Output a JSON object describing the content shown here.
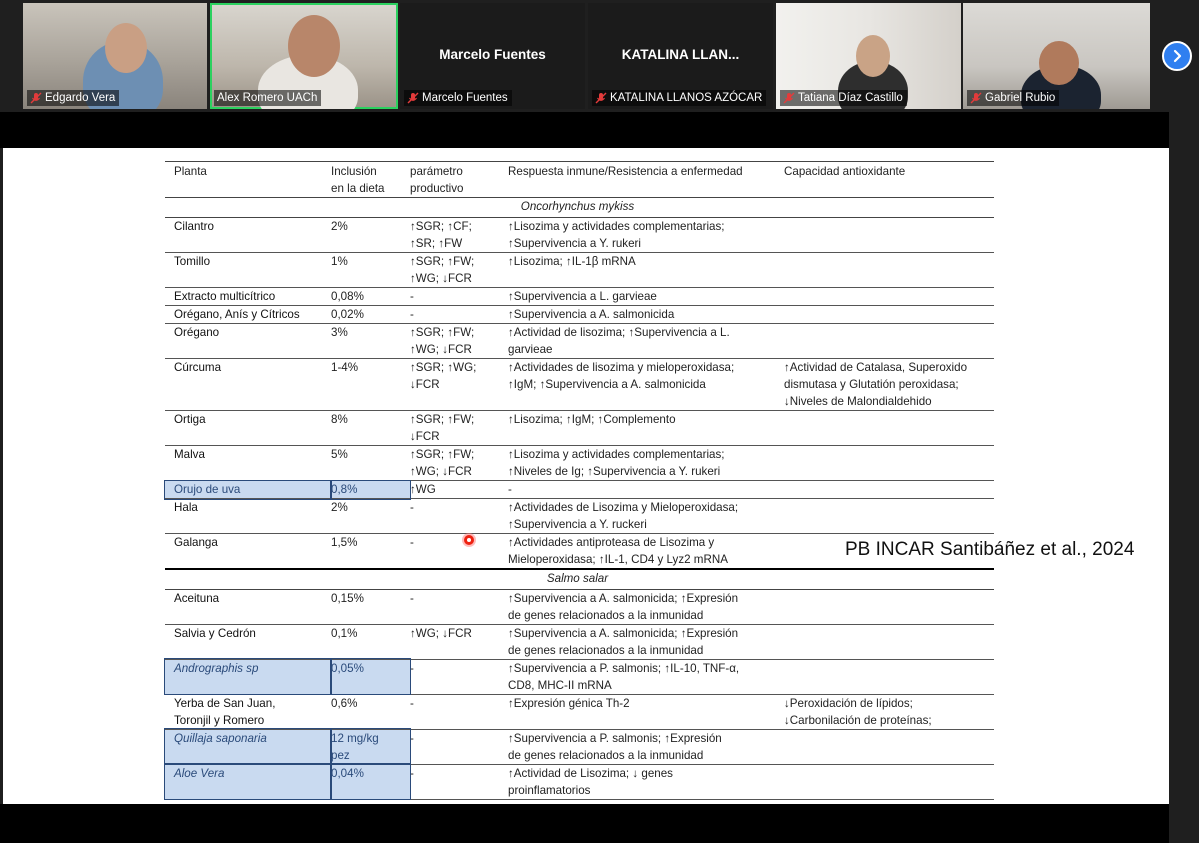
{
  "participants": [
    {
      "name": "Edgardo Vera",
      "muted": true,
      "video": true
    },
    {
      "name": "Alex Romero UACh",
      "muted": false,
      "video": true,
      "speaking": true
    },
    {
      "name": "Marcelo Fuentes",
      "center_label": "Marcelo Fuentes",
      "muted": true,
      "video": false
    },
    {
      "name": "KATALINA LLANOS AZÓCAR",
      "center_label": "KATALINA LLAN...",
      "muted": true,
      "video": false
    },
    {
      "name": "Tatiana Díaz Castillo",
      "muted": true,
      "video": true
    },
    {
      "name": "Gabriel Rubio",
      "muted": true,
      "video": true
    }
  ],
  "controls": {
    "next_icon": "chevron-right-icon",
    "accent": "#2f7ff0",
    "speaking_color": "#2bd15f",
    "mic_off_color": "#e33b3b"
  },
  "slide": {
    "headers": [
      "Planta",
      "Inclusión\nen la dieta",
      "parámetro\nproductivo",
      "Respuesta inmune/Resistencia a enfermedad",
      "Capacidad antioxidante"
    ],
    "sections": [
      {
        "species": "Oncorhynchus mykiss",
        "rows": [
          {
            "planta": "Cilantro",
            "inclusion": "2%",
            "parametro": "↑SGR; ↑CF;\n↑SR; ↑FW",
            "respuesta": "↑Lisozima y actividades complementarias;\n↑Supervivencia a Y. rukeri",
            "antioxidante": ""
          },
          {
            "planta": "Tomillo",
            "inclusion": "1%",
            "parametro": "↑SGR; ↑FW;\n↑WG; ↓FCR",
            "respuesta": "↑Lisozima; ↑IL-1β mRNA",
            "antioxidante": ""
          },
          {
            "planta": "Extracto multicítrico",
            "inclusion": "0,08%",
            "parametro": "-",
            "respuesta": "↑Supervivencia a L. garvieae",
            "antioxidante": ""
          },
          {
            "planta": "Orégano, Anís y Cítricos",
            "inclusion": "0,02%",
            "parametro": "-",
            "respuesta": "↑Supervivencia a A. salmonicida",
            "antioxidante": ""
          },
          {
            "planta": "Orégano",
            "inclusion": "3%",
            "parametro": "↑SGR; ↑FW;\n↑WG; ↓FCR",
            "respuesta": "↑Actividad de lisozima; ↑Supervivencia a L.\ngarvieae",
            "antioxidante": ""
          },
          {
            "planta": "Cúrcuma",
            "inclusion": "1-4%",
            "parametro": "↑SGR; ↑WG;\n↓FCR",
            "respuesta": "↑Actividades de lisozima y mieloperoxidasa;\n↑IgM; ↑Supervivencia a A. salmonicida",
            "antioxidante": "↑Actividad de Catalasa, Superoxido\ndismutasa y Glutatión peroxidasa;\n↓Niveles de Malondialdehido"
          },
          {
            "planta": "Ortiga",
            "inclusion": "8%",
            "parametro": "↑SGR; ↑FW;\n↓FCR",
            "respuesta": "↑Lisozima; ↑IgM; ↑Complemento",
            "antioxidante": ""
          },
          {
            "planta": "Malva",
            "inclusion": "5%",
            "parametro": "↑SGR; ↑FW;\n↑WG; ↓FCR",
            "respuesta": "↑Lisozima y actividades complementarias;\n↑Niveles de Ig; ↑Supervivencia a Y. rukeri",
            "antioxidante": ""
          },
          {
            "planta": "Orujo de uva",
            "inclusion": "0,8%",
            "parametro": "↑WG",
            "respuesta": "-",
            "antioxidante": "",
            "highlight": true,
            "plain": true
          },
          {
            "planta": "Hala",
            "inclusion": "2%",
            "parametro": "-",
            "respuesta": "↑Actividades de Lisozima y Mieloperoxidasa;\n↑Supervivencia a Y. ruckeri",
            "antioxidante": ""
          },
          {
            "planta": "Galanga",
            "inclusion": "1,5%",
            "parametro": "-",
            "respuesta": "↑Actividades antiproteasa de Lisozima y\nMieloperoxidasa; ↑IL-1, CD4 y Lyz2 mRNA",
            "antioxidante": ""
          }
        ]
      },
      {
        "species": "Salmo salar",
        "rows": [
          {
            "planta": "Aceituna",
            "inclusion": "0,15%",
            "parametro": "-",
            "respuesta": "↑Supervivencia a A. salmonicida; ↑Expresión\nde genes relacionados a la inmunidad",
            "antioxidante": ""
          },
          {
            "planta": "Salvia y Cedrón",
            "inclusion": "0,1%",
            "parametro": "↑WG; ↓FCR",
            "respuesta": "↑Supervivencia a A. salmonicida; ↑Expresión\nde genes relacionados a la inmunidad",
            "antioxidante": ""
          },
          {
            "planta": "Andrographis sp",
            "inclusion": "0,05%",
            "parametro": "-",
            "respuesta": "↑Supervivencia a P. salmonis; ↑IL-10, TNF-α,\nCD8, MHC-II mRNA",
            "antioxidante": "",
            "highlight": true
          },
          {
            "planta": "Yerba de San Juan,\nToronjil y Romero",
            "inclusion": "0,6%",
            "parametro": "-",
            "respuesta": "↑Expresión génica Th-2",
            "antioxidante": "↓Peroxidación de lípidos;\n↓Carbonilación de proteínas;"
          },
          {
            "planta": "Quillaja saponaria",
            "inclusion": "12 mg/kg\npez",
            "parametro": "-",
            "respuesta": "↑Supervivencia a P. salmonis; ↑Expresión\nde genes relacionados a la inmunidad",
            "antioxidante": "",
            "highlight": true
          },
          {
            "planta": "Aloe Vera",
            "inclusion": "0,04%",
            "parametro": "-",
            "respuesta": "↑Actividad de Lisozima; ↓ genes\nproinflamatorios",
            "antioxidante": "",
            "highlight": true
          }
        ]
      }
    ],
    "citation": "PB INCAR Santibáñez et al., 2024"
  }
}
